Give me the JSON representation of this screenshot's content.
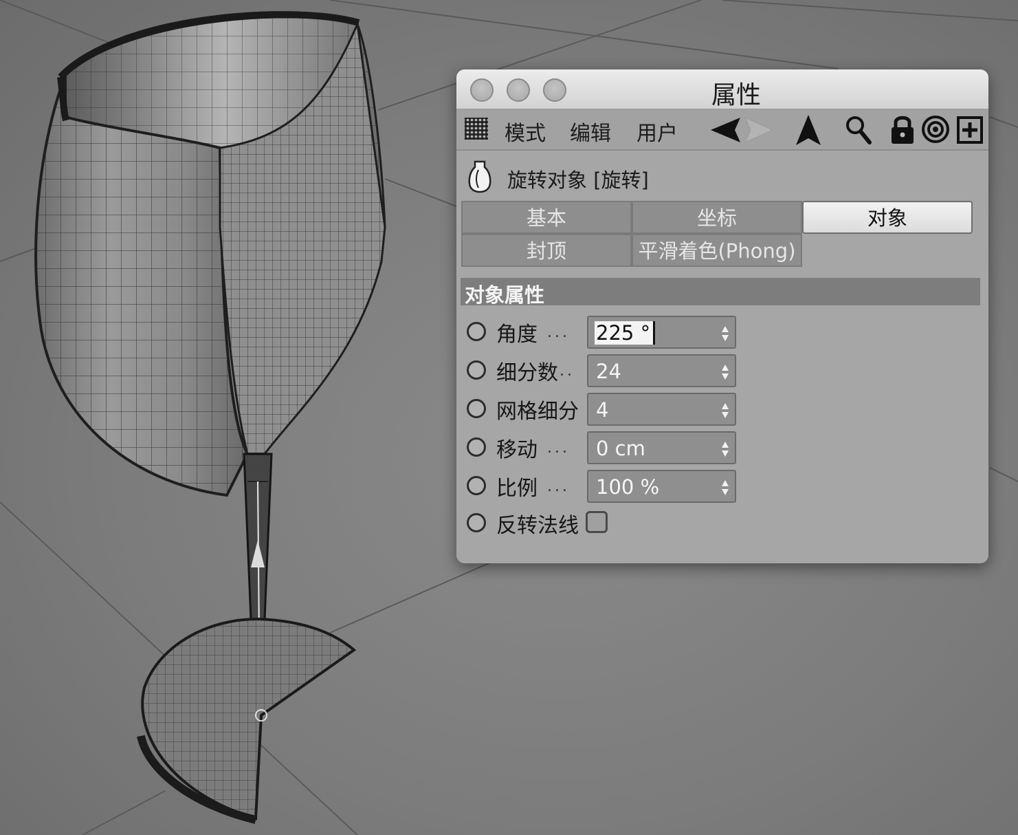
{
  "window": {
    "title": "属性"
  },
  "menu": {
    "items": [
      "模式",
      "编辑",
      "用户"
    ]
  },
  "toolbar_icons": [
    "grid-icon",
    "back-arrow-icon",
    "up-arrow-icon",
    "search-icon",
    "lock-icon",
    "target-icon",
    "new-panel-icon"
  ],
  "object": {
    "label": "旋转对象 [旋转]"
  },
  "tabs": [
    {
      "label": "基本",
      "active": false
    },
    {
      "label": "坐标",
      "active": false
    },
    {
      "label": "对象",
      "active": true
    },
    {
      "label": "封顶",
      "active": false
    },
    {
      "label": "平滑着色(Phong)",
      "active": false
    }
  ],
  "section": {
    "title": "对象属性"
  },
  "properties": [
    {
      "label": "角度",
      "dots": "...",
      "value": "225 °",
      "selected": true
    },
    {
      "label": "细分数",
      "dots": "..",
      "value": "24"
    },
    {
      "label": "网格细分",
      "dots": "",
      "value": "4"
    },
    {
      "label": "移动",
      "dots": "...",
      "value": "0 cm"
    },
    {
      "label": "比例",
      "dots": "...",
      "value": "100 %"
    }
  ],
  "checkbox_property": {
    "label": "反转法线",
    "checked": false
  },
  "colors": {
    "viewport_bg": "#7a7a7a",
    "panel_bg": "#a6a6a6",
    "active_tab": "#e8e8e8",
    "inactive_tab": "#8e8e8e"
  }
}
